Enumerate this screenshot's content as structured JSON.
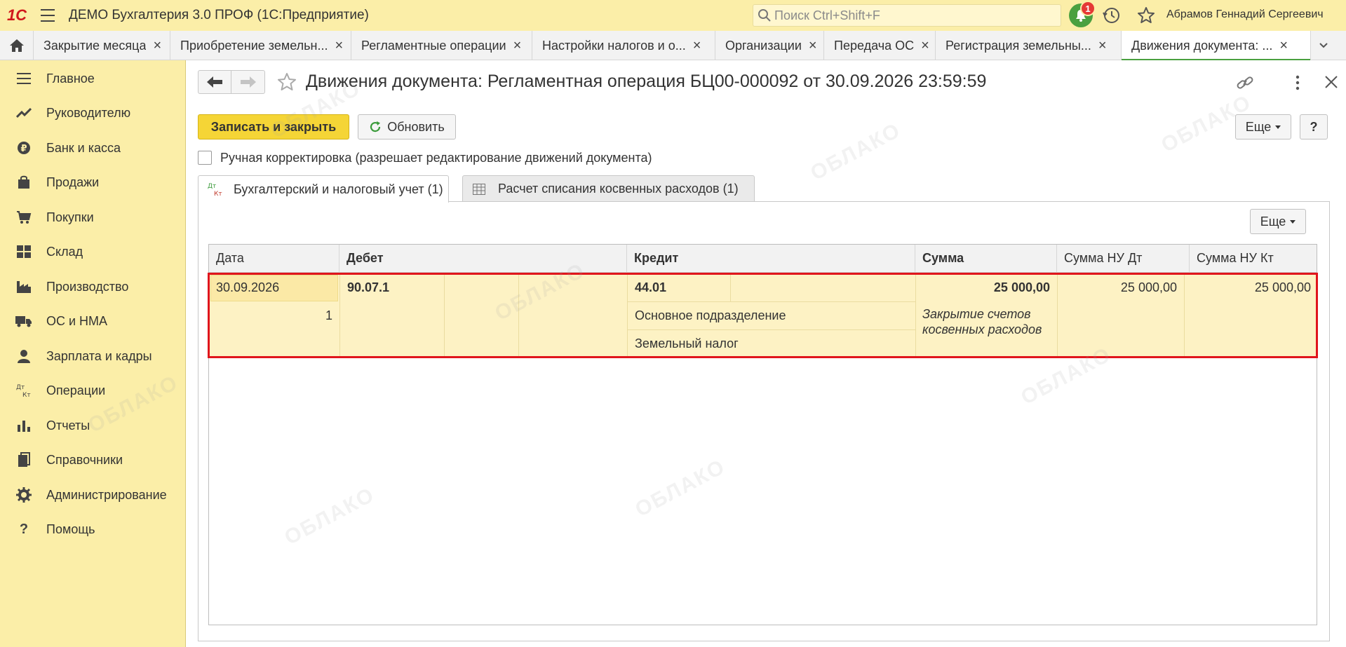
{
  "app": {
    "title": "ДЕМО Бухгалтерия 3.0 ПРОФ  (1С:Предприятие)",
    "logo": "1С",
    "search_placeholder": "Поиск Ctrl+Shift+F",
    "notifications_count": "1",
    "user_name": "Абрамов Геннадий Сергеевич"
  },
  "open_tabs": [
    {
      "label": "Закрытие месяца",
      "active": false
    },
    {
      "label": "Приобретение земельн...",
      "active": false
    },
    {
      "label": "Регламентные операции",
      "active": false
    },
    {
      "label": "Настройки налогов и о...",
      "active": false
    },
    {
      "label": "Организации",
      "active": false
    },
    {
      "label": "Передача ОС",
      "active": false
    },
    {
      "label": "Регистрация земельны...",
      "active": false
    },
    {
      "label": "Движения документа: ...",
      "active": true
    }
  ],
  "sidebar": {
    "items": [
      {
        "label": "Главное",
        "icon": "menu-icon"
      },
      {
        "label": "Руководителю",
        "icon": "trend-icon"
      },
      {
        "label": "Банк и касса",
        "icon": "coin-icon"
      },
      {
        "label": "Продажи",
        "icon": "bag-icon"
      },
      {
        "label": "Покупки",
        "icon": "cart-icon"
      },
      {
        "label": "Склад",
        "icon": "warehouse-icon"
      },
      {
        "label": "Производство",
        "icon": "factory-icon"
      },
      {
        "label": "ОС и НМА",
        "icon": "truck-icon"
      },
      {
        "label": "Зарплата и кадры",
        "icon": "person-icon"
      },
      {
        "label": "Операции",
        "icon": "dt-kt-icon"
      },
      {
        "label": "Отчеты",
        "icon": "bar-chart-icon"
      },
      {
        "label": "Справочники",
        "icon": "book-icon"
      },
      {
        "label": "Администрирование",
        "icon": "gear-icon"
      },
      {
        "label": "Помощь",
        "icon": "question-icon"
      }
    ]
  },
  "document": {
    "title": "Движения документа: Регламентная операция БЦ00-000092 от 30.09.2026 23:59:59",
    "save_close_label": "Записать и закрыть",
    "refresh_label": "Обновить",
    "more_label": "Еще",
    "help_label": "?",
    "manual_correction_label": "Ручная корректировка (разрешает редактирование движений документа)",
    "manual_correction_checked": false
  },
  "inner_tabs": [
    {
      "label": "Бухгалтерский и налоговый учет (1)",
      "icon": "dt-kt-icon",
      "active": true
    },
    {
      "label": "Расчет списания косвенных расходов (1)",
      "icon": "table-icon",
      "active": false
    }
  ],
  "grid": {
    "more_label": "Еще",
    "columns": [
      "Дата",
      "Дебет",
      "Кредит",
      "Сумма",
      "Сумма НУ Дт",
      "Сумма НУ Кт"
    ],
    "rows": [
      {
        "date": "30.09.2026",
        "number": "1",
        "debit_account": "90.07.1",
        "credit_account": "44.01",
        "credit_subconto1": "Основное подразделение",
        "credit_subconto2": "Земельный налог",
        "amount": "25 000,00",
        "content": "Закрытие счетов косвенных расходов",
        "nu_dt": "25 000,00",
        "nu_kt": "25 000,00"
      }
    ]
  },
  "watermark": "ОБЛАКО",
  "colors": {
    "sidebar_bg": "#fbeea8",
    "primary_button": "#f5d536",
    "active_tab_underline": "#4aa040",
    "selection_border": "#e0151c",
    "selected_row_bg": "#fdf2c4"
  }
}
